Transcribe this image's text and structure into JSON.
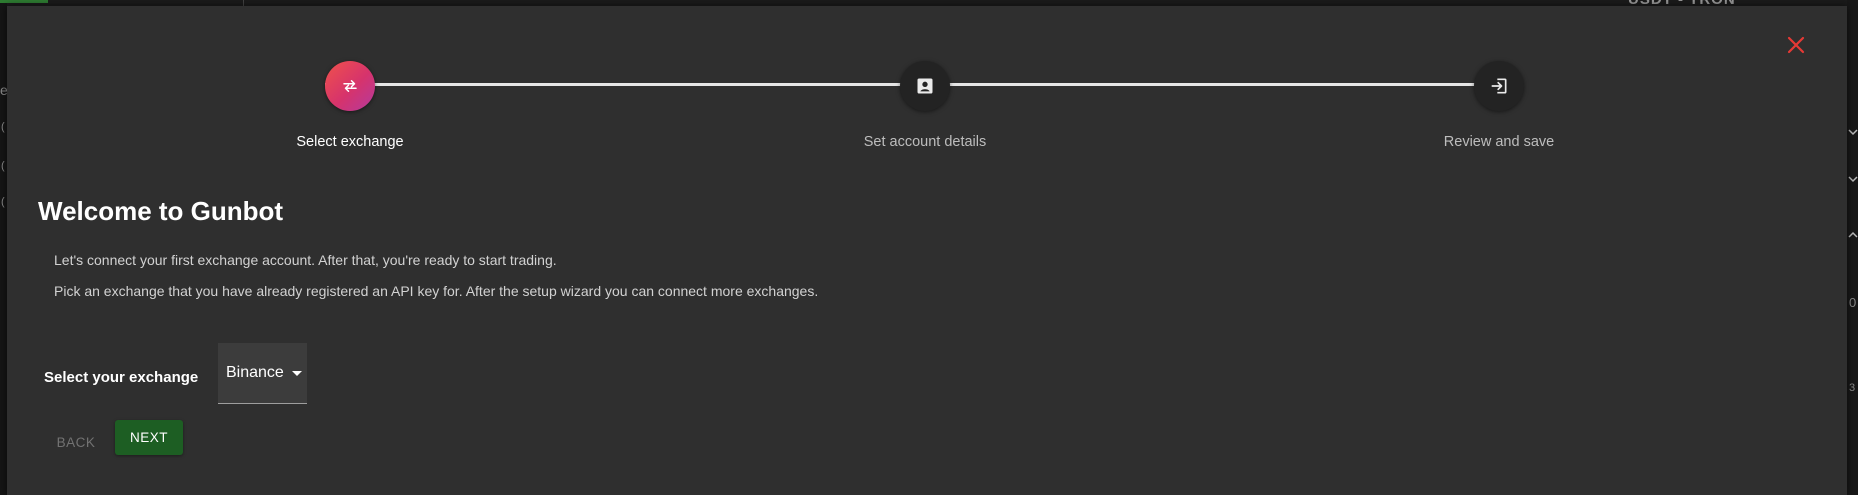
{
  "background": {
    "ticker_text": "USDT - TRON",
    "left_fragments": [
      "e",
      "(",
      "(",
      "("
    ],
    "right_fragments": [
      "0",
      "3"
    ]
  },
  "dialog": {
    "close_icon": "close-icon",
    "accent_color": "#e53935"
  },
  "stepper": {
    "steps": [
      {
        "label": "Select exchange",
        "icon": "swap-horiz-icon",
        "active": true
      },
      {
        "label": "Set account details",
        "icon": "account-box-icon",
        "active": false
      },
      {
        "label": "Review and save",
        "icon": "login-icon",
        "active": false
      }
    ]
  },
  "content": {
    "title": "Welcome to Gunbot",
    "intro_1": "Let's connect your first exchange account. After that, you're ready to start trading.",
    "intro_2": "Pick an exchange that you have already registered an API key for. After the setup wizard you can connect more exchanges.",
    "exchange_label": "Select your exchange",
    "exchange_value": "Binance"
  },
  "actions": {
    "back_label": "BACK",
    "next_label": "NEXT",
    "next_color": "#1d5e23"
  }
}
